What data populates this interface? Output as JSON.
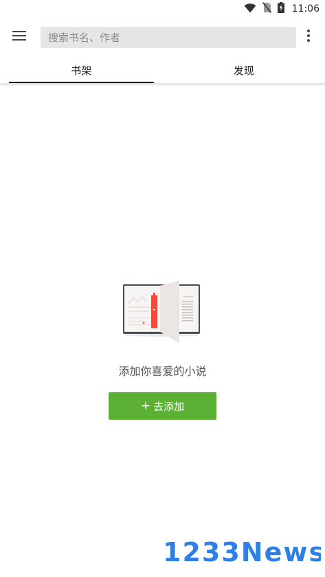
{
  "status_bar": {
    "time": "11:06",
    "icons": [
      "wifi-icon",
      "no-sim-icon",
      "battery-charging-icon"
    ]
  },
  "top_bar": {
    "menu_icon": "hamburger-menu-icon",
    "search": {
      "placeholder": "搜索书名、作者"
    },
    "more_icon": "more-vert-icon"
  },
  "tabs": [
    {
      "label": "书架",
      "active": true
    },
    {
      "label": "发现",
      "active": false
    }
  ],
  "empty_state": {
    "illustration": "open-book-illustration",
    "message": "添加你喜爱的小说",
    "button_plus": "+",
    "button_label": "去添加"
  },
  "watermark": {
    "text": "1233News"
  },
  "colors": {
    "accent_green": "#5cb135",
    "bookmark_red": "#f04a3c",
    "search_bg": "#e6e6e6",
    "watermark_blue": "#2f7fe8"
  }
}
